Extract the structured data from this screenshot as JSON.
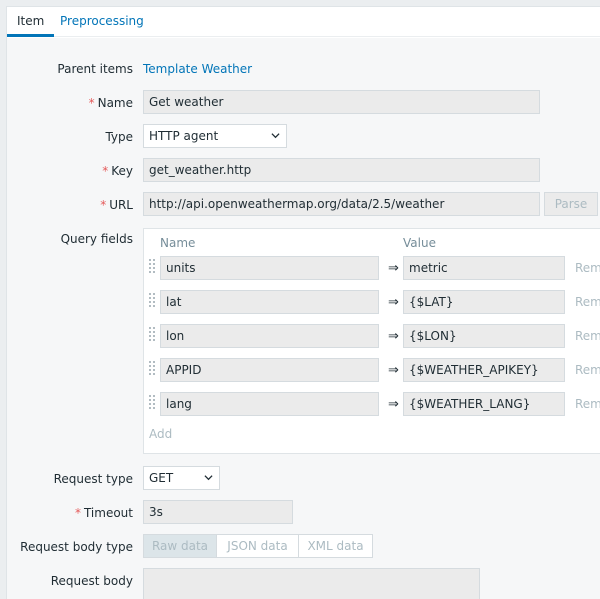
{
  "tabs": [
    {
      "label": "Item"
    },
    {
      "label": "Preprocessing"
    }
  ],
  "form": {
    "parent_items": {
      "label": "Parent items",
      "value": "Template Weather"
    },
    "name": {
      "label": "Name",
      "value": "Get weather"
    },
    "type": {
      "label": "Type",
      "value": "HTTP agent"
    },
    "key": {
      "label": "Key",
      "value": "get_weather.http"
    },
    "url": {
      "label": "URL",
      "value": "http://api.openweathermap.org/data/2.5/weather",
      "parse_label": "Parse"
    },
    "query_fields": {
      "label": "Query fields",
      "name_header": "Name",
      "value_header": "Value",
      "arrow": "⇒",
      "remove_label": "Remove",
      "add_label": "Add",
      "rows": [
        {
          "name": "units",
          "value": "metric"
        },
        {
          "name": "lat",
          "value": "{$LAT}"
        },
        {
          "name": "lon",
          "value": "{$LON}"
        },
        {
          "name": "APPID",
          "value": "{$WEATHER_APIKEY}"
        },
        {
          "name": "lang",
          "value": "{$WEATHER_LANG}"
        }
      ]
    },
    "request_type": {
      "label": "Request type",
      "value": "GET"
    },
    "timeout": {
      "label": "Timeout",
      "value": "3s"
    },
    "request_body_type": {
      "label": "Request body type",
      "options": [
        "Raw data",
        "JSON data",
        "XML data"
      ],
      "selected": "Raw data"
    },
    "request_body": {
      "label": "Request body",
      "value": ""
    }
  },
  "required_mark": "*",
  "colors": {
    "accent": "#0275b8",
    "required": "#e45959",
    "disabled_text": "#acbbc2"
  }
}
